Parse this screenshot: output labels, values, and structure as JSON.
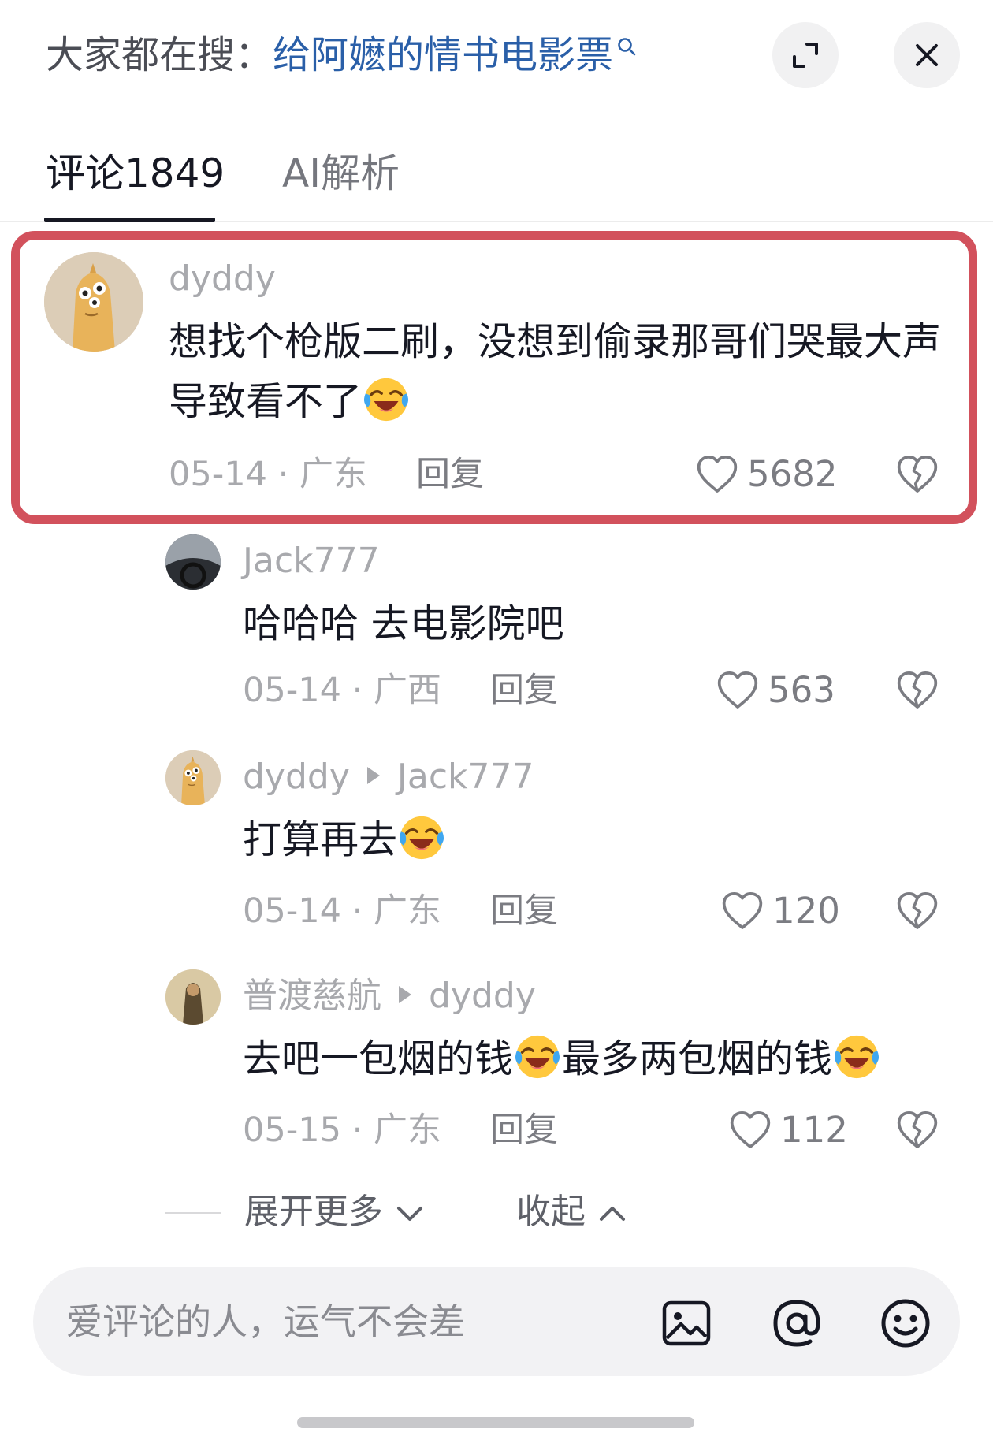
{
  "header": {
    "search_prefix": "大家都在搜：",
    "search_keyword": "给阿嬷的情书电影票",
    "expand_icon": "expand-icon",
    "close_icon": "close-icon"
  },
  "tabs": [
    {
      "label": "评论1849",
      "active": true
    },
    {
      "label": "AI解析",
      "active": false
    }
  ],
  "comments": [
    {
      "username": "dyddy",
      "text": "想找个枪版二刷，没想到偷录那哥们哭最大声导致看不了",
      "emoji": "laughing-crying-emoji",
      "date": "05-14",
      "location": "广东",
      "reply_label": "回复",
      "likes": "5682",
      "highlighted": true
    }
  ],
  "replies": [
    {
      "username": "Jack777",
      "reply_to": "",
      "text": "哈哈哈 去电影院吧",
      "date": "05-14",
      "location": "广西",
      "reply_label": "回复",
      "likes": "563"
    },
    {
      "username": "dyddy",
      "reply_to": "Jack777",
      "text": "打算再去",
      "emoji": "laughing-crying-emoji",
      "date": "05-14",
      "location": "广东",
      "reply_label": "回复",
      "likes": "120"
    },
    {
      "username": "普渡慈航",
      "reply_to": "dyddy",
      "text_part1": "去吧一包烟的钱",
      "text_part2": "最多两包烟的钱",
      "emoji": "laughing-crying-emoji",
      "date": "05-15",
      "location": "广东",
      "reply_label": "回复",
      "likes": "112"
    }
  ],
  "thread_controls": {
    "expand_more": "展开更多",
    "collapse": "收起"
  },
  "input": {
    "placeholder": "爱评论的人，运气不会差",
    "value": "",
    "icons": [
      "image-icon",
      "at-icon",
      "emoji-icon"
    ]
  },
  "colors": {
    "highlight_border": "#d2515c",
    "keyword": "#2a5fa8",
    "text_primary": "#161823",
    "text_secondary": "#a8a9ad"
  }
}
